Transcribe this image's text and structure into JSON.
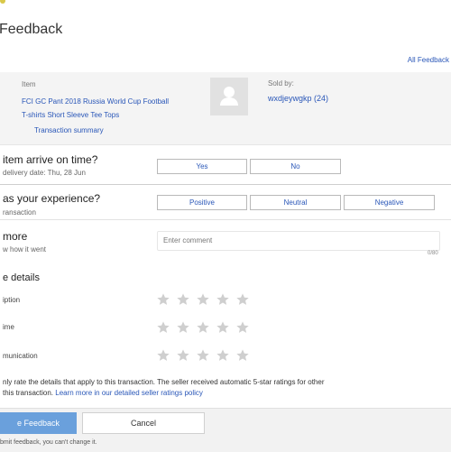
{
  "page": {
    "title": "Feedback",
    "all_feedback_link": "All Feedback"
  },
  "item": {
    "item_label": "Item",
    "title_line1": "FCI GC Pant 2018 Russia World Cup Football",
    "title_line2": "T-shirts Short Sleeve Tee Tops",
    "transaction_summary": "Transaction summary",
    "sold_by_label": "Sold by:",
    "seller": "wxdjeywgkp (24)"
  },
  "arrive": {
    "question": "Did the item arrive on time?",
    "question_visible": "item arrive on time?",
    "sub": "delivery date: Thu, 28 Jun",
    "yes": "Yes",
    "no": "No"
  },
  "experience": {
    "question_visible": "as your experience?",
    "sub": "ransaction",
    "positive": "Positive",
    "neutral": "Neutral",
    "negative": "Negative"
  },
  "more": {
    "title_visible": "more",
    "sub": "w how it went",
    "placeholder": "Enter comment",
    "counter": "0/80"
  },
  "details": {
    "title_visible": "e details",
    "rows": [
      {
        "label": "iption",
        "stars": 5
      },
      {
        "label": "ime",
        "stars": 5
      },
      {
        "label": "munication",
        "stars": 5
      }
    ]
  },
  "note": {
    "line1": "nly rate the details that apply to this transaction. The seller received automatic 5-star ratings for other",
    "line2_prefix": " this transaction. ",
    "line2_link": "Learn more in our detailed seller ratings policy"
  },
  "footer": {
    "leave": "e Feedback",
    "cancel": "Cancel",
    "note": "bmit feedback, you can't change it."
  },
  "colors": {
    "accent": "#2a57b8",
    "primary_button": "#6aa0dc",
    "star": "#cfcfcf"
  }
}
